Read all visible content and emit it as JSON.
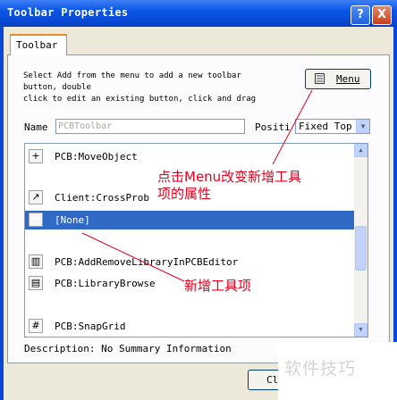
{
  "window": {
    "title": "Toolbar Properties",
    "help_glyph": "?",
    "close_glyph": "X"
  },
  "tab": {
    "label": "Toolbar"
  },
  "instructions": [
    "Select Add from the menu to add a new toolbar",
    "button, double",
    "click to edit an existing button, click and drag"
  ],
  "menu_button": {
    "label": "Menu",
    "icon": "menu-grid-icon"
  },
  "name_field": {
    "label": "Name",
    "placeholder": "PCBToolbar"
  },
  "position_field": {
    "label": "Positi",
    "value": "Fixed Top"
  },
  "list_items": [
    {
      "label": "PCB:MoveObject",
      "icon": "move-cross-icon",
      "glyph": "+",
      "selected": false
    },
    {
      "label": "Client:CrossProb",
      "icon": "cross-probe-icon",
      "glyph": "↗",
      "selected": false
    },
    {
      "label": "[None]",
      "icon": "none-icon",
      "glyph": "⚡",
      "selected": true
    },
    {
      "label": "PCB:AddRemoveLibraryInPCBEditor",
      "icon": "library-icon",
      "glyph": "▥",
      "selected": false
    },
    {
      "label": "PCB:LibraryBrowse",
      "icon": "library-browse-icon",
      "glyph": "▤",
      "selected": false
    },
    {
      "label": "PCB:SnapGrid",
      "icon": "grid-icon",
      "glyph": "#",
      "selected": false
    }
  ],
  "description": "Description: No Summary Information",
  "close_button": {
    "label": "Cl"
  },
  "annotations": {
    "menu_note_line1": "点击Menu改变新增工具",
    "menu_note_line2": "项的属性",
    "new_item_note": "新增工具项"
  },
  "watermark": "软件技巧",
  "colors": {
    "title_bar": "#0a55e6",
    "selection": "#316ac5",
    "annotation": "#e0001c"
  }
}
